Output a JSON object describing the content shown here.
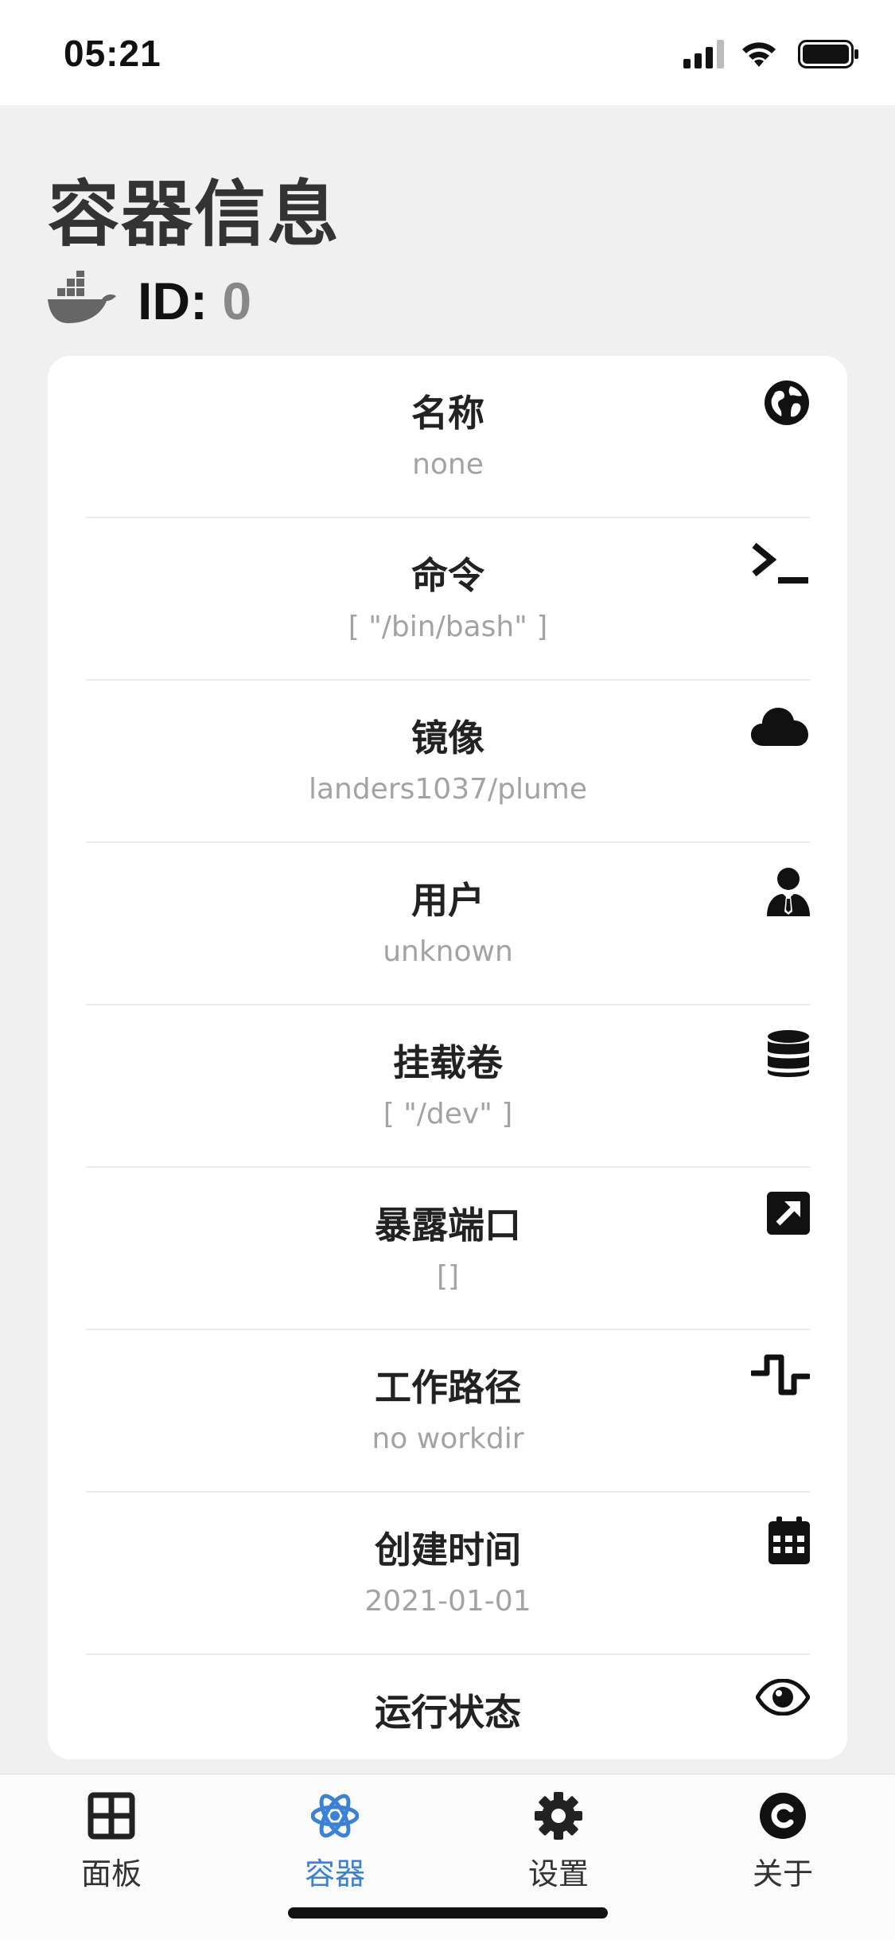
{
  "status_bar": {
    "time": "05:21"
  },
  "page": {
    "title": "容器信息",
    "id_label": "ID:",
    "id_value": "0"
  },
  "fields": [
    {
      "label": "名称",
      "value": "none",
      "icon": "globe-icon"
    },
    {
      "label": "命令",
      "value": "[ \"/bin/bash\" ]",
      "icon": "terminal-icon"
    },
    {
      "label": "镜像",
      "value": "landers1037/plume",
      "icon": "cloud-icon"
    },
    {
      "label": "用户",
      "value": "unknown",
      "icon": "user-tie-icon"
    },
    {
      "label": "挂载卷",
      "value": "[ \"/dev\" ]",
      "icon": "database-icon"
    },
    {
      "label": "暴露端口",
      "value": "[]",
      "icon": "external-link-icon"
    },
    {
      "label": "工作路径",
      "value": "no workdir",
      "icon": "wave-icon"
    },
    {
      "label": "创建时间",
      "value": "2021-01-01",
      "icon": "calendar-icon"
    },
    {
      "label": "运行状态",
      "value": "",
      "icon": "eye-icon"
    }
  ],
  "tabs": [
    {
      "label": "面板",
      "icon": "grid-icon"
    },
    {
      "label": "容器",
      "icon": "atom-icon",
      "active": true
    },
    {
      "label": "设置",
      "icon": "gear-icon"
    },
    {
      "label": "关于",
      "icon": "copyright-icon"
    }
  ],
  "colors": {
    "accent": "#3b82d6",
    "background": "#f0f0f0",
    "card": "#ffffff",
    "muted_text": "#a3a3a3"
  }
}
